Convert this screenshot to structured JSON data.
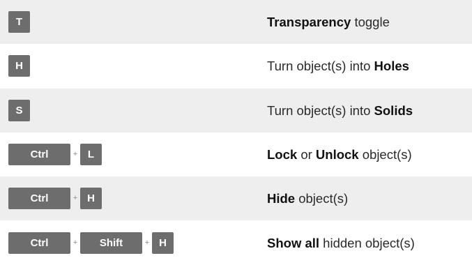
{
  "shortcuts": [
    {
      "keys": [
        "T"
      ],
      "desc": {
        "bold1": "Transparency",
        "text1": " toggle"
      }
    },
    {
      "keys": [
        "H"
      ],
      "desc": {
        "text1": "Turn object(s) into ",
        "bold1": "Holes"
      }
    },
    {
      "keys": [
        "S"
      ],
      "desc": {
        "text1": "Turn object(s) into ",
        "bold1": "Solids"
      }
    },
    {
      "keys": [
        "Ctrl",
        "L"
      ],
      "desc": {
        "bold1": "Lock",
        "text1": " or ",
        "bold2": "Unlock",
        "text2": " object(s)"
      }
    },
    {
      "keys": [
        "Ctrl",
        "H"
      ],
      "desc": {
        "bold1": "Hide",
        "text1": " object(s)"
      }
    },
    {
      "keys": [
        "Ctrl",
        "Shift",
        "H"
      ],
      "desc": {
        "bold1": "Show all",
        "text1": " hidden object(s)"
      }
    }
  ],
  "plus_symbol": "+",
  "colors": {
    "key_background": "#6d6d6d",
    "key_text": "#ffffff",
    "row_shaded": "#eeeeee",
    "row_plain": "#ffffff"
  }
}
